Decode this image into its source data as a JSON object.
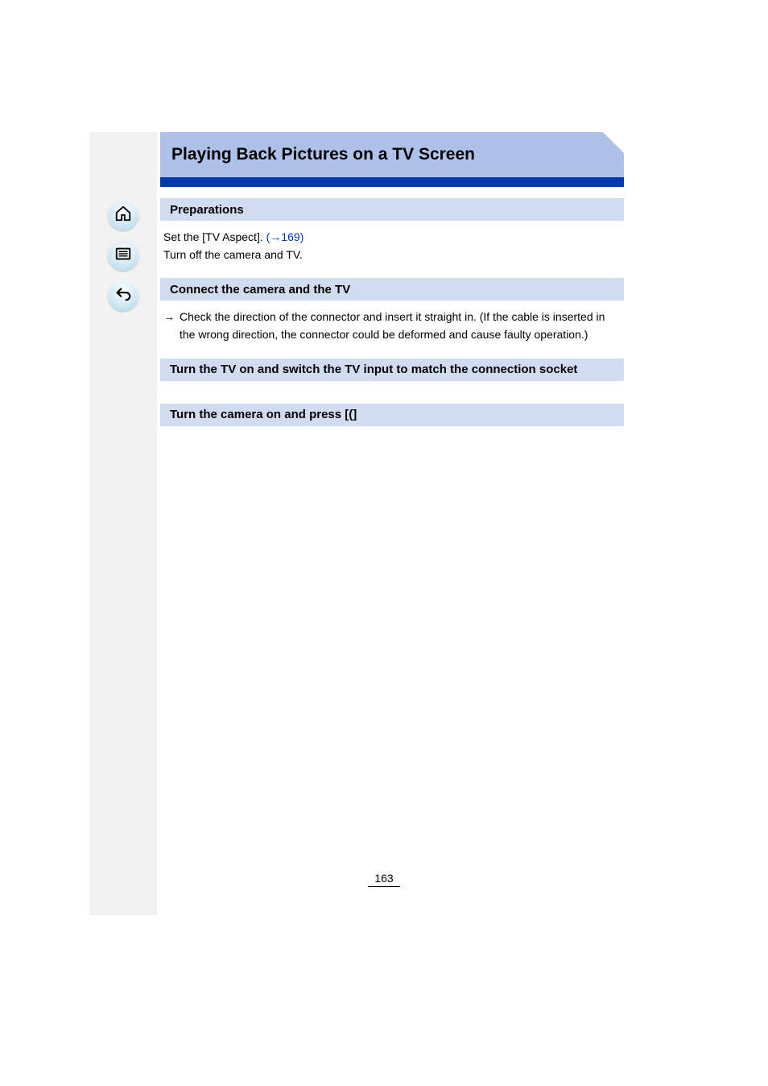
{
  "title": "Playing Back Pictures on a TV Screen",
  "sections": [
    {
      "header": "Preparations",
      "body_plain": "Set the [TV Aspect]. (→169)\nTurn off the camera and TV."
    },
    {
      "header": "Connect the camera and the TV",
      "body_arrow": "Check the direction of the connector and insert it straight in. (If the cable is inserted in the wrong direction, the connector could be deformed and cause faulty operation.)"
    },
    {
      "header": "Turn the TV on and switch the TV input to match the connection socket",
      "body_plain": ""
    },
    {
      "header": "Turn the camera on and press [(]",
      "body_plain": ""
    }
  ],
  "page_link_ref": "169",
  "page_number": "163",
  "nav": {
    "home": "home-icon",
    "list": "list-icon",
    "back": "back-icon"
  }
}
